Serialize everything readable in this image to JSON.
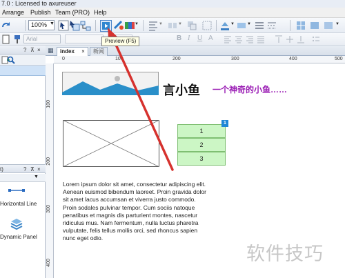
{
  "window": {
    "title": "7.0 : Licensed to axureuser"
  },
  "menu": {
    "items": [
      "Arrange",
      "Publish",
      "Team (PRO)",
      "Help"
    ]
  },
  "toolbar": {
    "zoom": "100%",
    "font_name": "Arial"
  },
  "tooltip": {
    "text": "Preview (F5)"
  },
  "tabs": {
    "active": "index",
    "second": "新闻"
  },
  "left_panel": {
    "widget_header_suffix": "t)",
    "help_q": "?",
    "pin": "⊼",
    "close": "×",
    "widgets": [
      "Horizontal Line",
      "Dynamic Panel"
    ]
  },
  "ruler": {
    "h_ticks": [
      "0",
      "100",
      "200",
      "300",
      "400",
      "500"
    ],
    "v_ticks": [
      "100",
      "200",
      "300",
      "400"
    ]
  },
  "canvas": {
    "heading": "言小鱼",
    "subtitle": "一个神奇的小鱼……",
    "table_rows": [
      "1",
      "2",
      "3"
    ],
    "badge": "1",
    "paragraph": "Lorem ipsum dolor sit amet, consectetur adipiscing elit. Aenean euismod bibendum laoreet. Proin gravida dolor sit amet lacus accumsan et viverra justo commodo. Proin sodales pulvinar tempor. Cum sociis natoque penatibus et magnis dis parturient montes, nascetur ridiculus mus. Nam fermentum, nulla luctus pharetra vulputate, felis tellus mollis orci, sed rhoncus sapien nunc eget odio."
  },
  "watermark": "软件技巧",
  "colors": {
    "accent_blue": "#2a8fc9",
    "subtitle_purple": "#9a1cb4",
    "table_fill": "#ccf6c5",
    "arrow_red": "#d6322e"
  }
}
